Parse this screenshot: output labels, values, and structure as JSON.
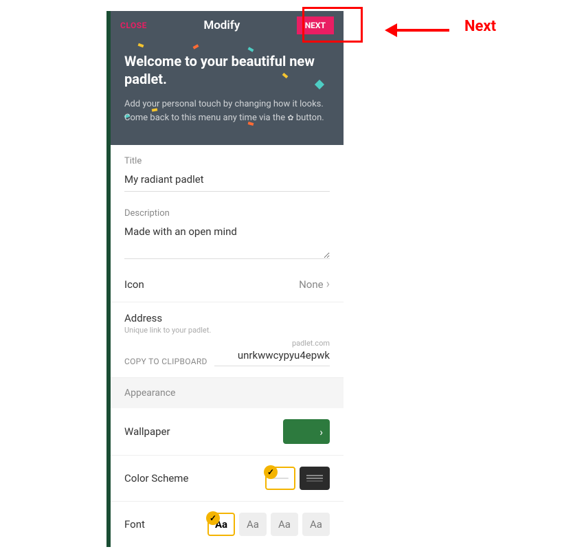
{
  "topbar": {
    "close": "CLOSE",
    "title": "Modify",
    "next": "NEXT"
  },
  "hero": {
    "welcome": "Welcome to your beautiful new padlet.",
    "subtitle_a": "Add your personal touch by changing how it looks. Come back to this menu any time via the ",
    "subtitle_b": " button."
  },
  "fields": {
    "title_label": "Title",
    "title_value": "My radiant padlet",
    "desc_label": "Description",
    "desc_value": "Made with an open mind",
    "icon_label": "Icon",
    "icon_value": "None"
  },
  "address": {
    "label": "Address",
    "hint": "Unique link to your padlet.",
    "copy": "COPY TO CLIPBOARD",
    "domain": "padlet.com",
    "slug": "unrkwwcypyu4epwk"
  },
  "appearance": {
    "header": "Appearance",
    "wallpaper": "Wallpaper",
    "colorscheme": "Color Scheme",
    "font": "Font",
    "font_options": [
      "Aa",
      "Aa",
      "Aa",
      "Aa"
    ]
  },
  "annotation": {
    "label": "Next"
  }
}
